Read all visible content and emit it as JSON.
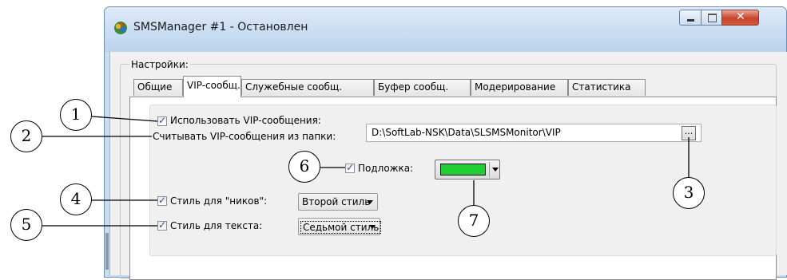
{
  "window": {
    "title": "SMSManager #1 - Остановлен",
    "group_label": "Настройки:"
  },
  "tabs": [
    {
      "label": "Общие",
      "active": false
    },
    {
      "label": "VIP-сообщ.",
      "active": true
    },
    {
      "label": "Служебные сообщ.",
      "active": false
    },
    {
      "label": "Буфер сообщ.",
      "active": false
    },
    {
      "label": "Модерирование",
      "active": false
    },
    {
      "label": "Статистика",
      "active": false
    }
  ],
  "vip": {
    "use_vip_label": "Использовать VIP-сообщения:",
    "use_vip_checked": true,
    "folder_label": "Считывать VIP-сообщения из папки:",
    "folder_value": "D:\\SoftLab-NSK\\Data\\SLSMSMonitor\\VIP",
    "browse_label": "...",
    "backdrop_label": "Подложка:",
    "backdrop_checked": true,
    "backdrop_color": "#22cc33",
    "nick_style_label": "Стиль для \"ников\":",
    "nick_style_checked": true,
    "nick_style_value": "Второй стиль",
    "text_style_label": "Стиль для текста:",
    "text_style_checked": true,
    "text_style_value": "Седьмой стиль"
  },
  "callouts": [
    "1",
    "2",
    "3",
    "4",
    "5",
    "6",
    "7"
  ]
}
